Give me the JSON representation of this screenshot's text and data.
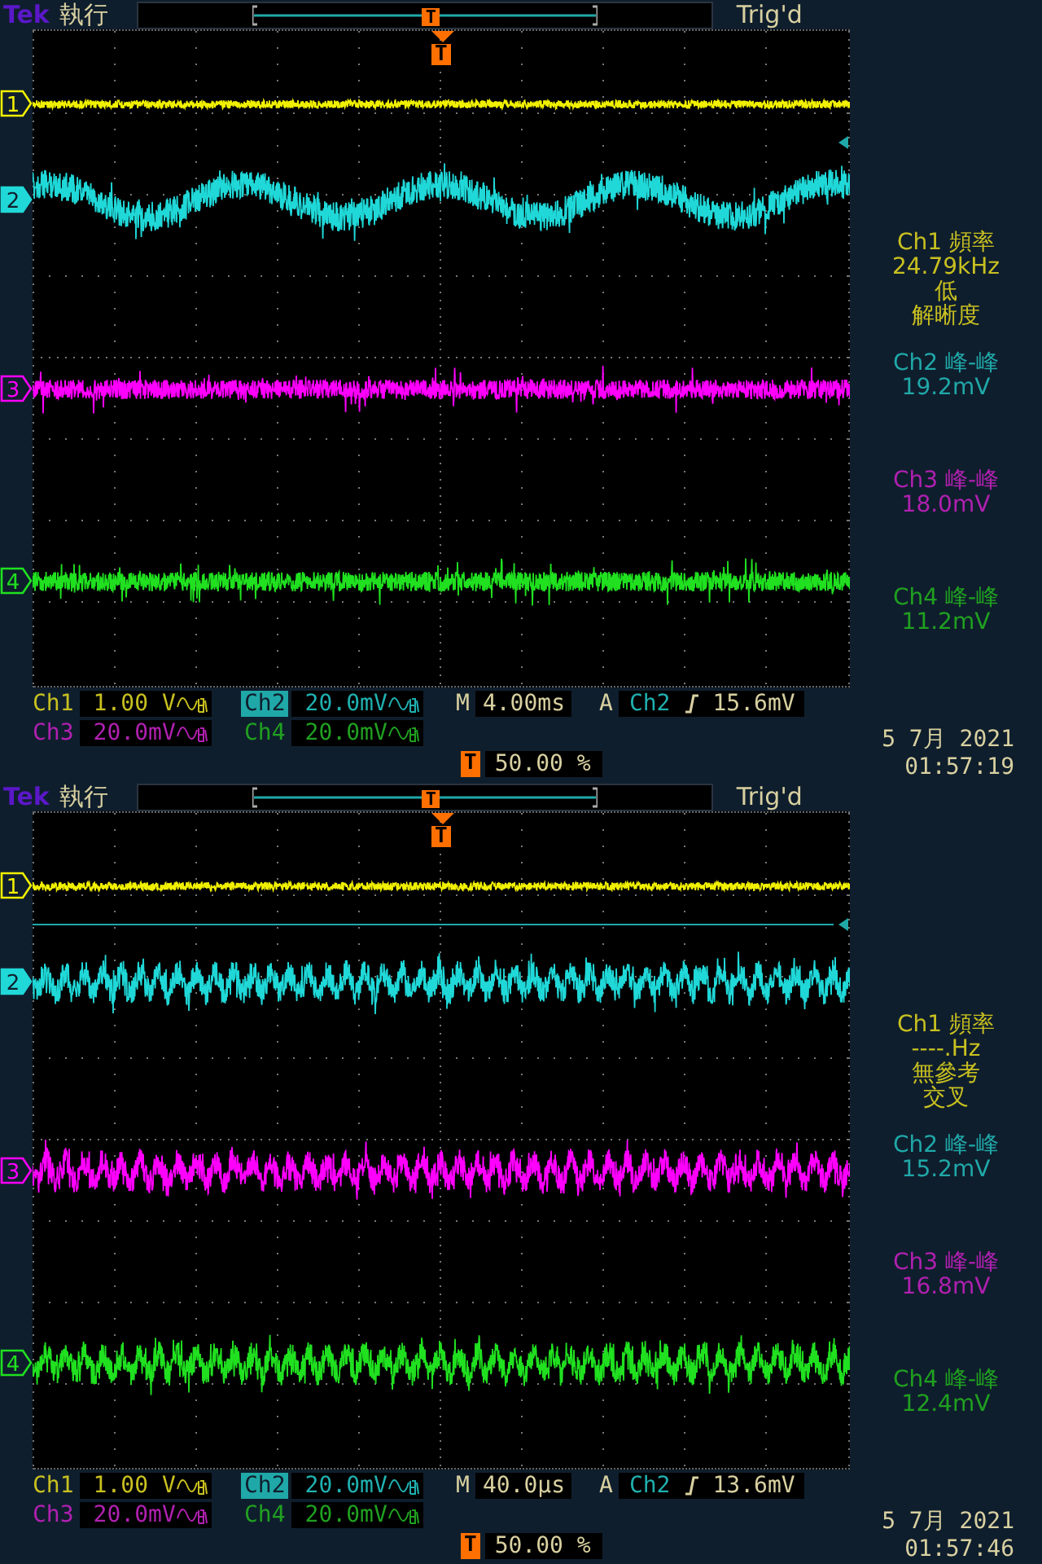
{
  "screens": [
    {
      "header": {
        "brand": "Tek",
        "run_state": "執行",
        "trigger_marker": "T",
        "trigger_status": "Trig'd"
      },
      "graticule": {
        "trigger_marker": "T",
        "trigger_level_line": false
      },
      "channels": [
        {
          "label": "1",
          "color": "#f0f000",
          "selected": false,
          "kind": "flat"
        },
        {
          "label": "2",
          "color": "#20d8d8",
          "selected": true,
          "kind": "sine"
        },
        {
          "label": "3",
          "color": "#ff00ff",
          "selected": false,
          "kind": "noise"
        },
        {
          "label": "4",
          "color": "#20e020",
          "selected": false,
          "kind": "noise"
        }
      ],
      "measurements": [
        {
          "color": "#c8c020",
          "lines": [
            "Ch1 頻率",
            "24.79kHz",
            "低",
            "解晰度"
          ]
        },
        {
          "color": "#20a8a8",
          "lines": [
            "Ch2 峰-峰",
            "19.2mV"
          ]
        },
        {
          "color": "#b020b0",
          "lines": [
            "Ch3 峰-峰",
            "18.0mV"
          ]
        },
        {
          "color": "#20a020",
          "lines": [
            "Ch4 峰-峰",
            "11.2mV"
          ]
        }
      ],
      "vertical": [
        {
          "channel": "Ch1",
          "scale": "1.00 V",
          "selected": false,
          "color": "#c8c020"
        },
        {
          "channel": "Ch2",
          "scale": "20.0mV",
          "selected": true,
          "color": "#20b0b0"
        },
        {
          "channel": "Ch3",
          "scale": "20.0mV",
          "selected": false,
          "color": "#b020b0"
        },
        {
          "channel": "Ch4",
          "scale": "20.0mV",
          "selected": false,
          "color": "#20a020"
        }
      ],
      "horizontal": {
        "label": "M",
        "timebase": "4.00ms"
      },
      "trigger": {
        "label": "A",
        "source": "Ch2",
        "threshold": "15.6mV"
      },
      "trigger_position": {
        "marker": "T",
        "value": "50.00 %"
      },
      "date": "5 7月 2021",
      "time": "01:57:19"
    },
    {
      "header": {
        "brand": "Tek",
        "run_state": "執行",
        "trigger_marker": "T",
        "trigger_status": "Trig'd"
      },
      "graticule": {
        "trigger_marker": "T",
        "trigger_level_line": true
      },
      "channels": [
        {
          "label": "1",
          "color": "#f0f000",
          "selected": false,
          "kind": "flat"
        },
        {
          "label": "2",
          "color": "#20d8d8",
          "selected": true,
          "kind": "ripple"
        },
        {
          "label": "3",
          "color": "#ff00ff",
          "selected": false,
          "kind": "ripple"
        },
        {
          "label": "4",
          "color": "#20e020",
          "selected": false,
          "kind": "ripple"
        }
      ],
      "measurements": [
        {
          "color": "#c8c020",
          "lines": [
            "Ch1 頻率",
            "----.Hz",
            "無參考",
            "交叉"
          ]
        },
        {
          "color": "#20a8a8",
          "lines": [
            "Ch2 峰-峰",
            "15.2mV"
          ]
        },
        {
          "color": "#b020b0",
          "lines": [
            "Ch3 峰-峰",
            "16.8mV"
          ]
        },
        {
          "color": "#20a020",
          "lines": [
            "Ch4 峰-峰",
            "12.4mV"
          ]
        }
      ],
      "vertical": [
        {
          "channel": "Ch1",
          "scale": "1.00 V",
          "selected": false,
          "color": "#c8c020"
        },
        {
          "channel": "Ch2",
          "scale": "20.0mV",
          "selected": true,
          "color": "#20b0b0"
        },
        {
          "channel": "Ch3",
          "scale": "20.0mV",
          "selected": false,
          "color": "#b020b0"
        },
        {
          "channel": "Ch4",
          "scale": "20.0mV",
          "selected": false,
          "color": "#20a020"
        }
      ],
      "horizontal": {
        "label": "M",
        "timebase": "40.0µs"
      },
      "trigger": {
        "label": "A",
        "source": "Ch2",
        "threshold": "13.6mV"
      },
      "trigger_position": {
        "marker": "T",
        "value": "50.00 %"
      },
      "date": "5 7月 2021",
      "time": "01:57:46"
    }
  ]
}
